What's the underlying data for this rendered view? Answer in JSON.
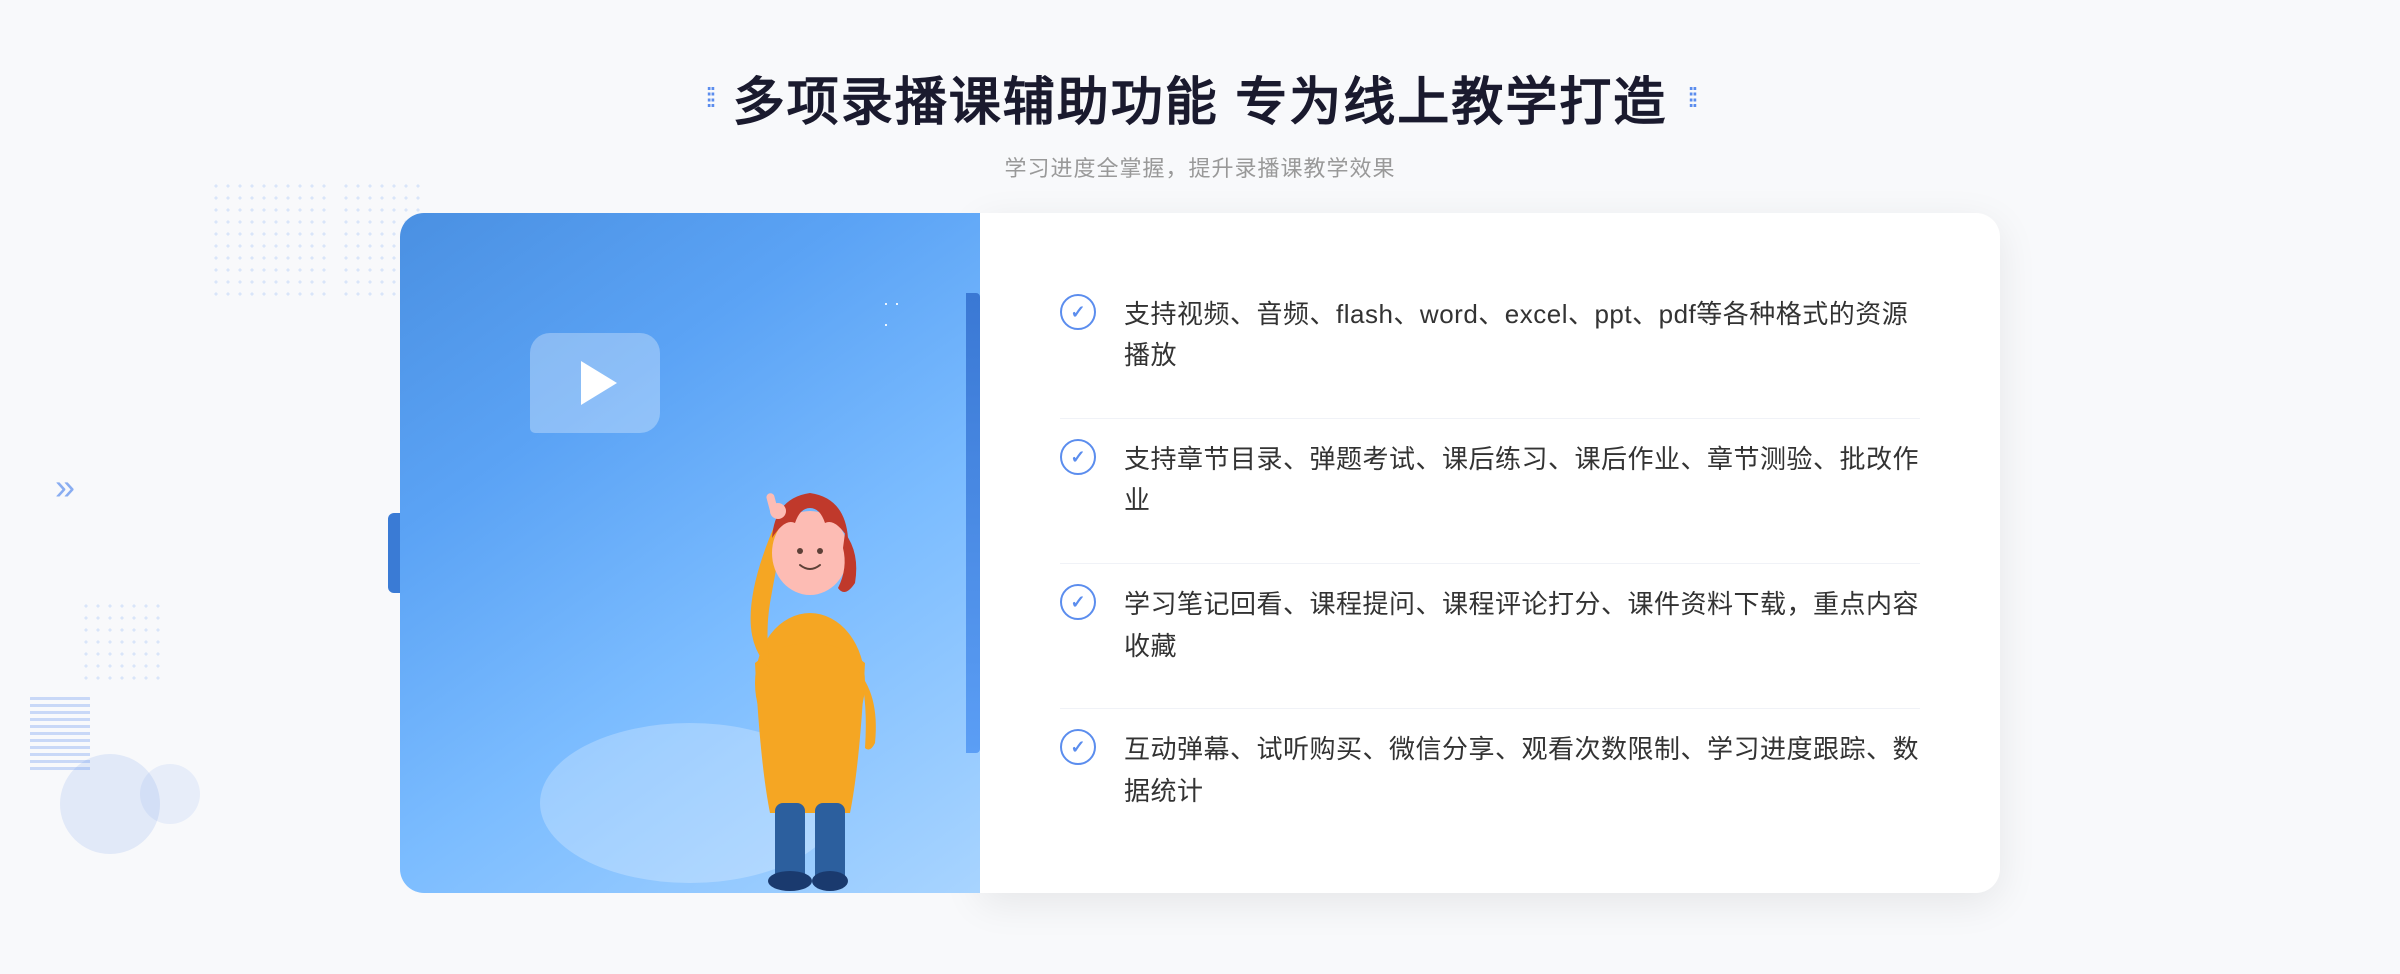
{
  "header": {
    "title": "多项录播课辅助功能 专为线上教学打造",
    "subtitle": "学习进度全掌握，提升录播课教学效果",
    "title_dots_left": "⁞⁞",
    "title_dots_right": "⁞⁞"
  },
  "features": [
    {
      "id": 1,
      "text": "支持视频、音频、flash、word、excel、ppt、pdf等各种格式的资源播放"
    },
    {
      "id": 2,
      "text": "支持章节目录、弹题考试、课后练习、课后作业、章节测验、批改作业"
    },
    {
      "id": 3,
      "text": "学习笔记回看、课程提问、课程评论打分、课件资料下载，重点内容收藏"
    },
    {
      "id": 4,
      "text": "互动弹幕、试听购买、微信分享、观看次数限制、学习进度跟踪、数据统计"
    }
  ],
  "arrows": {
    "left": "»",
    "check_symbol": "✓"
  }
}
